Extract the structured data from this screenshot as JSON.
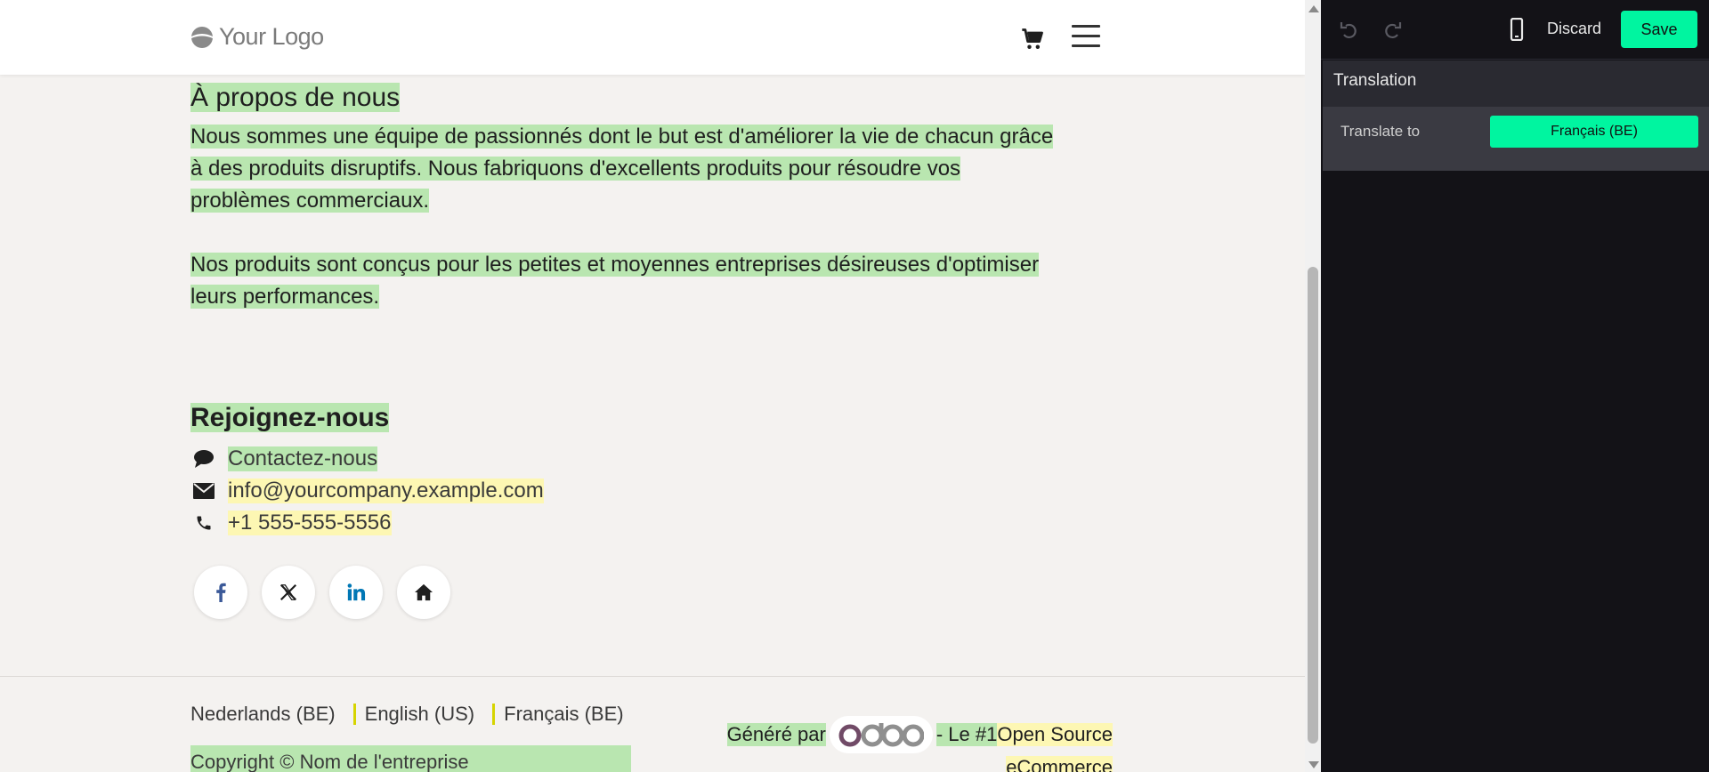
{
  "header": {
    "logo_text": "Your Logo"
  },
  "about": {
    "title": "À propos de nous",
    "paragraph1_line1": "Nous sommes une équipe de passionnés dont le but est d'améliorer la vie de chacun grâce",
    "paragraph1_line2": "à des produits disruptifs. Nous fabriquons d'excellents produits pour résoudre vos",
    "paragraph1_line3": "problèmes commerciaux.",
    "paragraph2_line1": "Nos produits sont conçus pour les petites et moyennes entreprises désireuses d'optimiser",
    "paragraph2_line2": "leurs performances."
  },
  "join": {
    "title": "Rejoignez-nous",
    "contacts": [
      {
        "icon": "comment-icon",
        "text": "Contactez-nous"
      },
      {
        "icon": "envelope-icon",
        "text": "info@yourcompany.example.com"
      },
      {
        "icon": "phone-icon",
        "text": "+1 555-555-5556"
      }
    ],
    "social": [
      "facebook-icon",
      "x-icon",
      "linkedin-icon",
      "home-icon"
    ]
  },
  "footer": {
    "languages": [
      "Nederlands (BE)",
      "English (US)",
      "Français (BE)"
    ],
    "copyright": "Copyright © Nom de l'entreprise",
    "powered_prefix": "Généré par",
    "powered_brand": "odoo",
    "powered_suffix": "- Le #1",
    "powered_link1": "Open Source",
    "powered_link2": "eCommerce"
  },
  "editor": {
    "discard_label": "Discard",
    "save_label": "Save",
    "panel_title": "Translation",
    "translate_to_label": "Translate to",
    "translate_to_value": "Français (BE)"
  },
  "colors": {
    "accent": "#00f5a0",
    "highlight_green": "#b9e6b0",
    "highlight_yellow": "#fdf7b3",
    "editor_bg": "#131217"
  }
}
